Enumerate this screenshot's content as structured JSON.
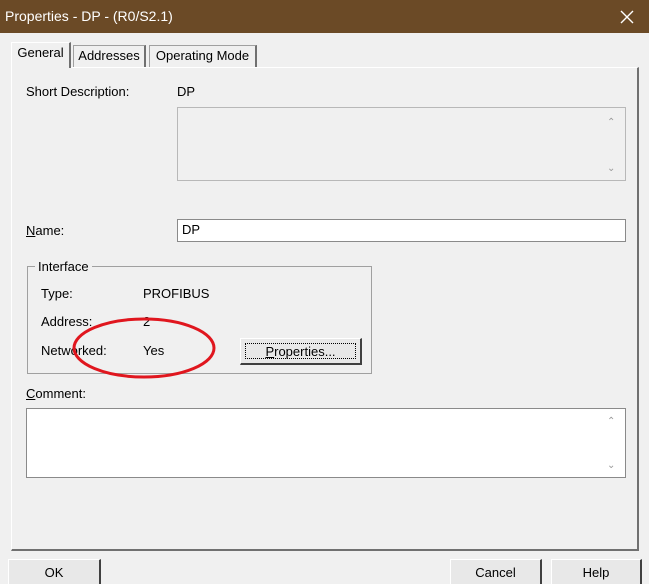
{
  "window": {
    "title": "Properties - DP - (R0/S2.1)"
  },
  "tabs": [
    {
      "label": "General",
      "active": true
    },
    {
      "label": "Addresses",
      "active": false
    },
    {
      "label": "Operating Mode",
      "active": false
    }
  ],
  "general": {
    "short_description_label": "Short Description:",
    "short_description_value": "DP",
    "name_label_prefix": "N",
    "name_label_rest": "ame:",
    "name_value": "DP",
    "interface": {
      "title": "Interface",
      "type_label": "Type:",
      "type_value": "PROFIBUS",
      "address_label": "Address:",
      "address_value": "2",
      "networked_label": "Networked:",
      "networked_value": "Yes",
      "properties_button_prefix": "P",
      "properties_button_rest": "roperties..."
    },
    "comment_label_prefix": "C",
    "comment_label_rest": "omment:",
    "comment_value": ""
  },
  "buttons": {
    "ok": "OK",
    "cancel": "Cancel",
    "help": "Help"
  },
  "annotation": {
    "highlight_color": "#e0161e"
  }
}
